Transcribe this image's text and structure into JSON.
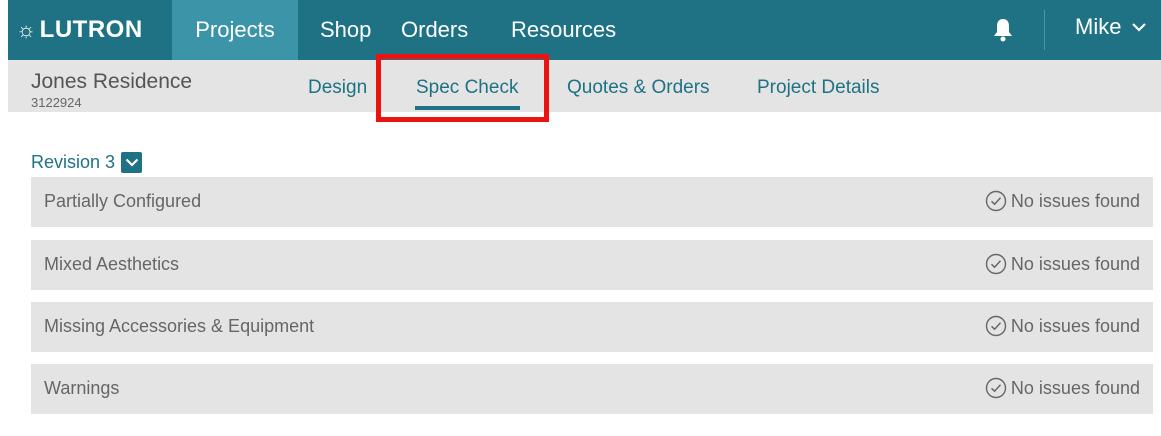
{
  "nav": {
    "logo": "LUTRON",
    "items": [
      {
        "label": "Projects"
      },
      {
        "label": "Shop"
      },
      {
        "label": "Orders"
      },
      {
        "label": "Resources"
      }
    ],
    "user": "Mike",
    "colors": {
      "bar": "#1e7284",
      "active": "#3b94a7"
    }
  },
  "project": {
    "name": "Jones Residence",
    "number": "3122924"
  },
  "tabs": [
    {
      "label": "Design"
    },
    {
      "label": "Spec Check"
    },
    {
      "label": "Quotes & Orders"
    },
    {
      "label": "Project Details"
    }
  ],
  "revision": {
    "label": "Revision 3"
  },
  "checks": [
    {
      "label": "Partially Configured",
      "status": "No issues found"
    },
    {
      "label": "Mixed Aesthetics",
      "status": "No issues found"
    },
    {
      "label": "Missing Accessories & Equipment",
      "status": "No issues found"
    },
    {
      "label": "Warnings",
      "status": "No issues found"
    }
  ],
  "icons": [
    "sun-logo-icon",
    "bell-icon",
    "chevron-down-icon",
    "check-circle-icon"
  ],
  "highlight_color": "#ee1111"
}
